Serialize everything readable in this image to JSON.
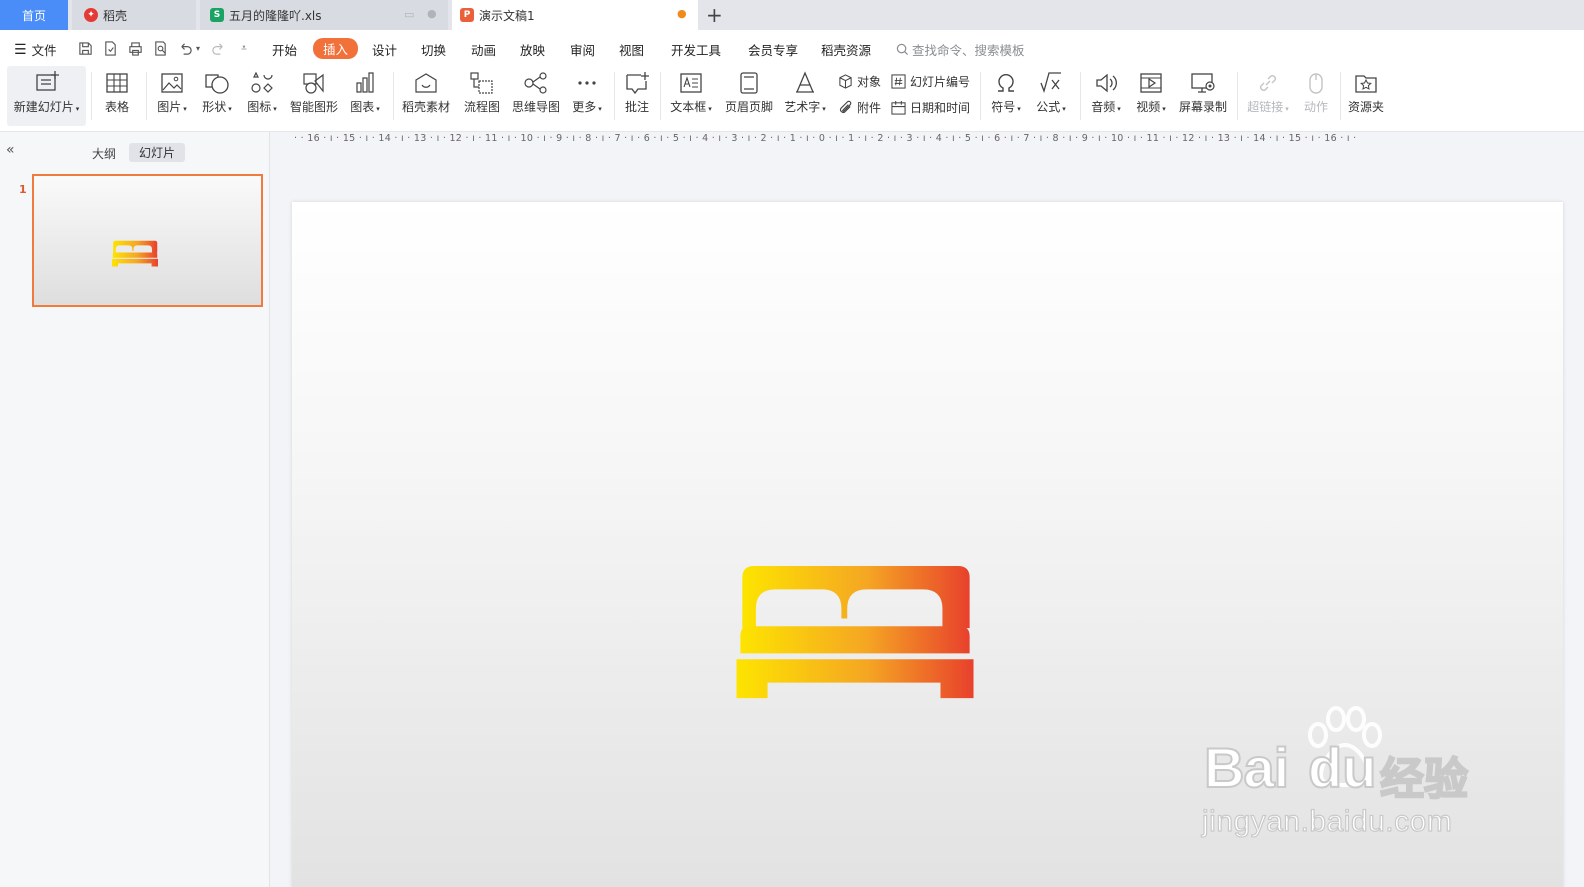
{
  "tabs": {
    "home": "首页",
    "docer": "稻壳",
    "xls": "五月的隆隆吖.xls",
    "ppt": "演示文稿1"
  },
  "menu": {
    "file": "文件",
    "items": [
      "开始",
      "插入",
      "设计",
      "切换",
      "动画",
      "放映",
      "审阅",
      "视图",
      "开发工具",
      "会员专享",
      "稻壳资源"
    ],
    "search": "查找命令、搜索模板"
  },
  "ribbon": {
    "new_slide": "新建幻灯片",
    "table": "表格",
    "picture": "图片",
    "shape": "形状",
    "icon": "图标",
    "smartart": "智能图形",
    "chart": "图表",
    "docer_material": "稻壳素材",
    "flowchart": "流程图",
    "mindmap": "思维导图",
    "more": "更多",
    "comment": "批注",
    "textbox": "文本框",
    "header_footer": "页眉页脚",
    "wordart": "艺术字",
    "object": "对象",
    "attachment": "附件",
    "slide_number": "幻灯片编号",
    "date_time": "日期和时间",
    "symbol": "符号",
    "formula": "公式",
    "audio": "音频",
    "video": "视频",
    "screen_record": "屏幕录制",
    "hyperlink": "超链接",
    "action": "动作",
    "resource_folder": "资源夹"
  },
  "panel": {
    "outline_tab": "大纲",
    "slides_tab": "幻灯片",
    "slide_number": "1"
  },
  "ruler": {
    "labels": [
      "16",
      "15",
      "14",
      "13",
      "12",
      "11",
      "10",
      "9",
      "8",
      "7",
      "6",
      "5",
      "4",
      "3",
      "2",
      "1",
      "0",
      "1",
      "2",
      "3",
      "4",
      "5",
      "6",
      "7",
      "8",
      "9",
      "10",
      "11",
      "12",
      "13",
      "14",
      "15",
      "16"
    ]
  },
  "watermark": {
    "brand_left": "Bai",
    "brand_right": "du",
    "brand_cn": "经验",
    "url": "jingyan.baidu.com"
  },
  "colors": {
    "accent": "#f2713b",
    "home_tab": "#4a8df8",
    "bed_gradient_start": "#fde400",
    "bed_gradient_end": "#e8412c"
  }
}
